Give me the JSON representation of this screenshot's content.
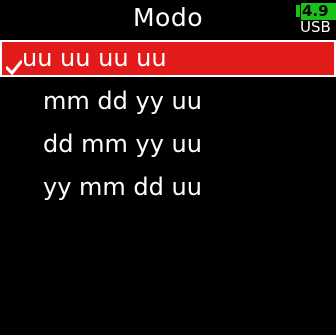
{
  "header": {
    "title": "Modo"
  },
  "battery": {
    "level": "4.9",
    "source": "USB",
    "color": "#19c219"
  },
  "menu": {
    "selected_color": "#e31a1a",
    "selected_icon": "checkmark-icon",
    "items": [
      {
        "label": "uu uu uu uu",
        "selected": true
      },
      {
        "label": "mm dd yy uu",
        "selected": false
      },
      {
        "label": "dd mm yy uu",
        "selected": false
      },
      {
        "label": "yy mm dd uu",
        "selected": false
      }
    ]
  }
}
